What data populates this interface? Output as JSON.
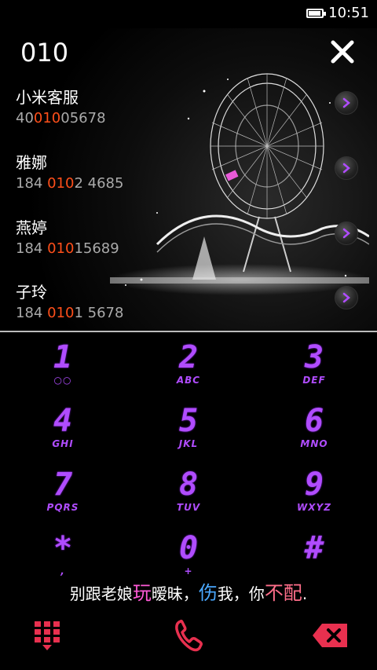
{
  "status": {
    "time": "10:51",
    "battery_level": 0.9
  },
  "search": {
    "query": "010"
  },
  "contacts": [
    {
      "name": "小米客服",
      "num_pre": "40",
      "num_hl": "010",
      "num_post": "05678"
    },
    {
      "name": "雅娜",
      "num_pre": "184 ",
      "num_hl": "010",
      "num_post": "2 4685"
    },
    {
      "name": "燕婷",
      "num_pre": "184 ",
      "num_hl": "010",
      "num_post": "15689"
    },
    {
      "name": "子玲",
      "num_pre": "184 ",
      "num_hl": "010",
      "num_post": "1 5678"
    }
  ],
  "keys": [
    {
      "digit": "1",
      "letters": "○○"
    },
    {
      "digit": "2",
      "letters": "ABC"
    },
    {
      "digit": "3",
      "letters": "DEF"
    },
    {
      "digit": "4",
      "letters": "GHI"
    },
    {
      "digit": "5",
      "letters": "JKL"
    },
    {
      "digit": "6",
      "letters": "MNO"
    },
    {
      "digit": "7",
      "letters": "PQRS"
    },
    {
      "digit": "8",
      "letters": "TUV"
    },
    {
      "digit": "9",
      "letters": "WXYZ"
    },
    {
      "digit": "*",
      "letters": ","
    },
    {
      "digit": "0",
      "letters": "+"
    },
    {
      "digit": "#",
      "letters": ""
    }
  ],
  "slogan": {
    "p1": "别跟老娘",
    "p2": "玩",
    "p3": "暧昧，",
    "p4": "伤",
    "p5": "我，你",
    "p6": "不配",
    "p7": "."
  },
  "colors": {
    "accent": "#b04cff",
    "highlight": "#ff4f1a",
    "action": "#e8304f"
  },
  "icons": {
    "keypad": "dialpad-icon",
    "call": "phone-icon",
    "delete": "backspace-icon",
    "close": "close-icon",
    "detail": "chevron-right-icon"
  }
}
